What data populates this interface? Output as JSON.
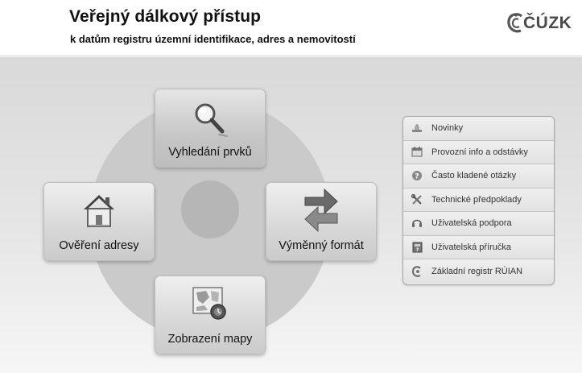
{
  "header": {
    "title": "Veřejný dálkový přístup",
    "subtitle": "k datům registru územní identifikace, adres a nemovitostí",
    "logo_text": "ČÚZK"
  },
  "tiles": {
    "top": {
      "label": "Vyhledání prvků",
      "icon": "magnifier-icon"
    },
    "left": {
      "label": "Ověření adresy",
      "icon": "house-icon"
    },
    "right": {
      "label": "Výměnný formát",
      "icon": "exchange-arrows-icon"
    },
    "bottom": {
      "label": "Zobrazení mapy",
      "icon": "map-icon"
    }
  },
  "menu": {
    "items": [
      {
        "label": "Novinky",
        "icon": "news-icon"
      },
      {
        "label": "Provozní info a odstávky",
        "icon": "calendar-icon"
      },
      {
        "label": "Často kladené otázky",
        "icon": "question-icon"
      },
      {
        "label": "Technické předpoklady",
        "icon": "tools-icon"
      },
      {
        "label": "Uživatelská podpora",
        "icon": "headset-icon"
      },
      {
        "label": "Uživatelská příručka",
        "icon": "book-icon"
      },
      {
        "label": "Základní registr RÚIAN",
        "icon": "registry-icon"
      }
    ]
  },
  "colors": {
    "background_top": "#d9d9d9",
    "ring": "#cacaca",
    "hub": "#b6b6b6",
    "tile": "#d7d7d7"
  }
}
